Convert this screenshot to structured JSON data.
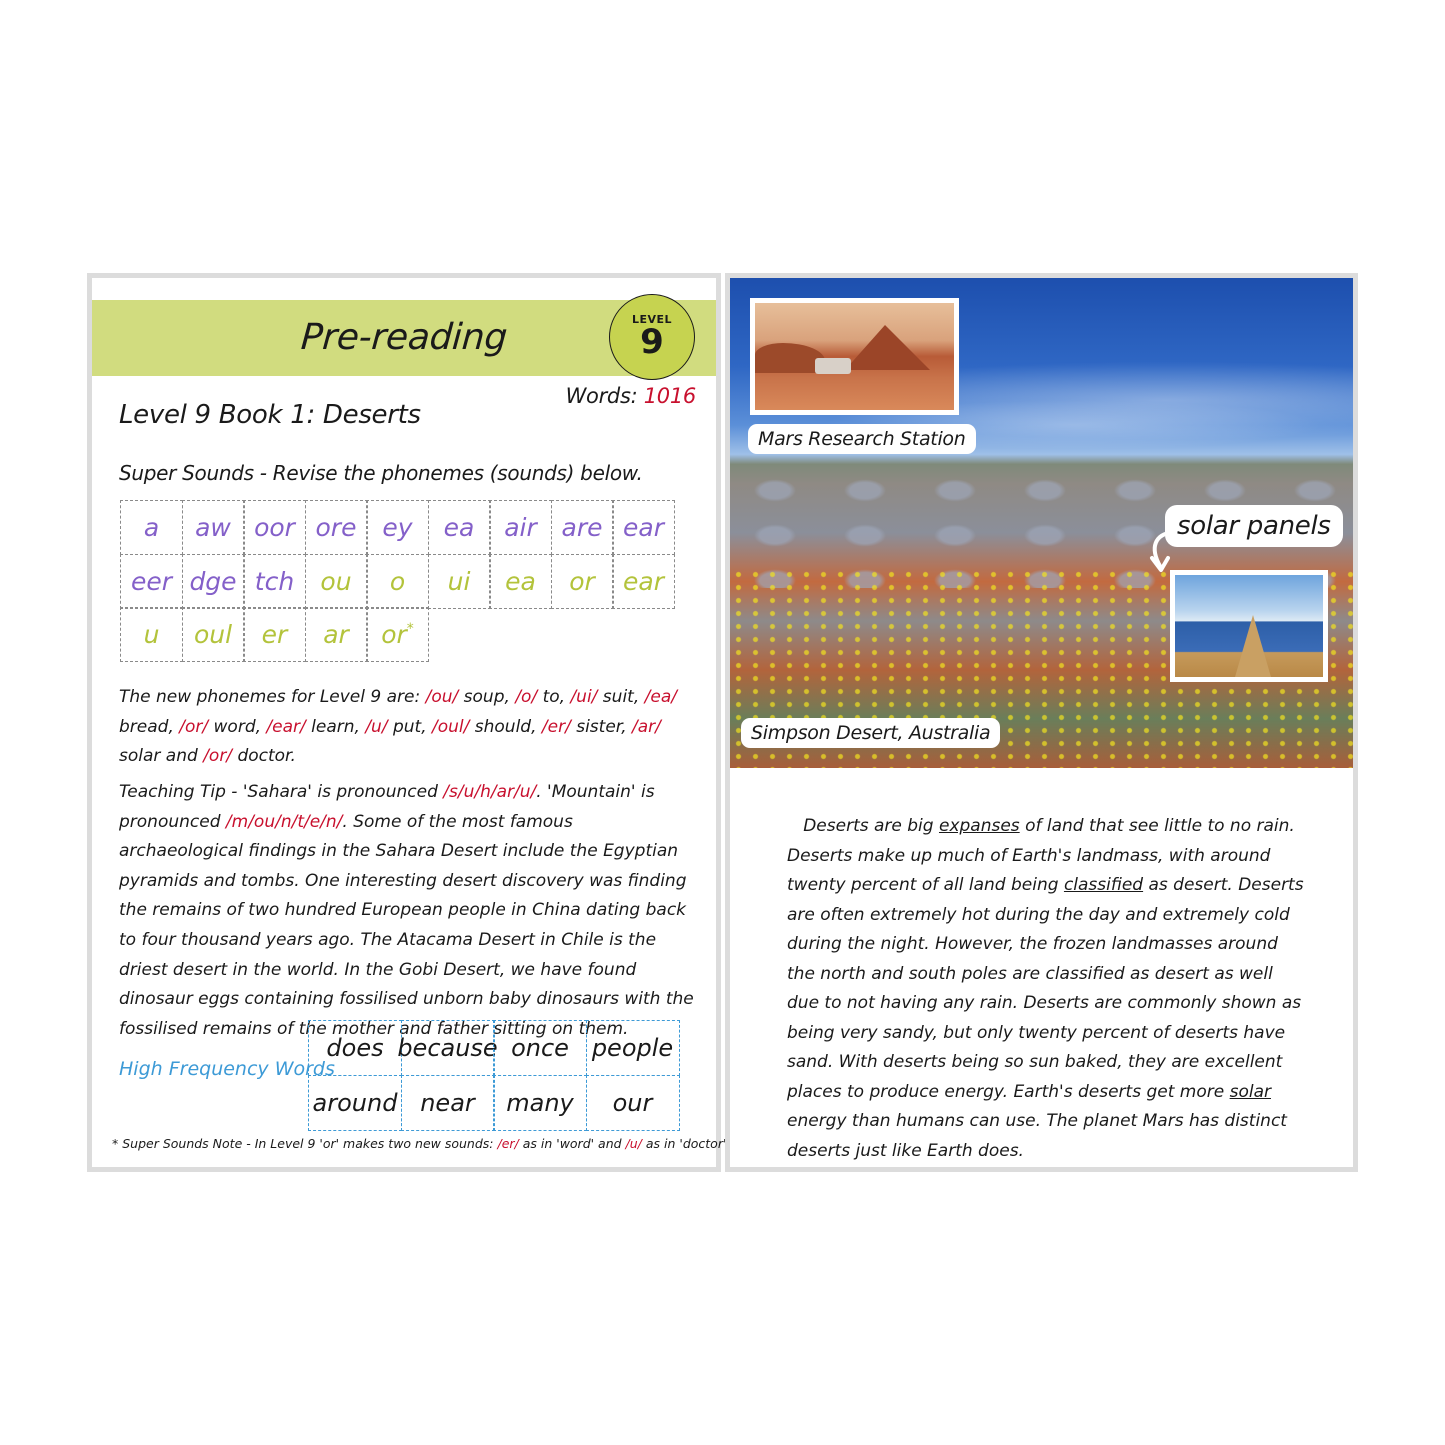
{
  "left_page": {
    "banner_title": "Pre-reading",
    "level_badge": {
      "label": "LEVEL",
      "number": "9"
    },
    "word_count": {
      "label": "Words: ",
      "value": "1016"
    },
    "book_title": "Level 9 Book 1: Deserts",
    "super_sounds_title": "Super Sounds - Revise the phonemes (sounds) below.",
    "phoneme_grid": [
      [
        {
          "text": "a",
          "color": "purple"
        },
        {
          "text": "aw",
          "color": "purple"
        },
        {
          "text": "oor",
          "color": "purple"
        },
        {
          "text": "ore",
          "color": "purple"
        },
        {
          "text": "ey",
          "color": "purple"
        },
        {
          "text": "ea",
          "color": "purple"
        },
        {
          "text": "air",
          "color": "purple"
        },
        {
          "text": "are",
          "color": "purple"
        },
        {
          "text": "ear",
          "color": "purple"
        }
      ],
      [
        {
          "text": "eer",
          "color": "purple"
        },
        {
          "text": "dge",
          "color": "purple"
        },
        {
          "text": "tch",
          "color": "purple"
        },
        {
          "text": "ou",
          "color": "lime"
        },
        {
          "text": "o",
          "color": "lime"
        },
        {
          "text": "ui",
          "color": "lime"
        },
        {
          "text": "ea",
          "color": "lime"
        },
        {
          "text": "or",
          "color": "lime"
        },
        {
          "text": "ear",
          "color": "lime"
        }
      ],
      [
        {
          "text": "u",
          "color": "lime"
        },
        {
          "text": "oul",
          "color": "lime"
        },
        {
          "text": "er",
          "color": "lime"
        },
        {
          "text": "ar",
          "color": "lime"
        },
        {
          "text": "or",
          "color": "lime",
          "mark": "*"
        }
      ]
    ],
    "new_phonemes": [
      {
        "t": "The new phonemes for Level 9 are: "
      },
      {
        "t": "/ou/",
        "red": true
      },
      {
        "t": " soup, "
      },
      {
        "t": "/o/",
        "red": true
      },
      {
        "t": " to, "
      },
      {
        "t": "/ui/",
        "red": true
      },
      {
        "t": " suit, "
      },
      {
        "t": "/ea/",
        "red": true
      },
      {
        "t": " bread, "
      },
      {
        "t": "/or/",
        "red": true
      },
      {
        "t": " word, "
      },
      {
        "t": "/ear/",
        "red": true
      },
      {
        "t": " learn, "
      },
      {
        "t": "/u/",
        "red": true
      },
      {
        "t": " put, "
      },
      {
        "t": "/oul/",
        "red": true
      },
      {
        "t": " should, "
      },
      {
        "t": "/er/",
        "red": true
      },
      {
        "t": " sister, "
      },
      {
        "t": "/ar/",
        "red": true
      },
      {
        "t": " solar and "
      },
      {
        "t": "/or/",
        "red": true
      },
      {
        "t": " doctor."
      }
    ],
    "teaching_tip": [
      {
        "t": "Teaching Tip - 'Sahara' is pronounced "
      },
      {
        "t": "/s/u/h/ar/u/",
        "red": true
      },
      {
        "t": ". 'Mountain' is pronounced "
      },
      {
        "t": "/m/ou/n/t/e/n/",
        "red": true
      },
      {
        "t": ". Some of the most famous archaeological findings in the Sahara Desert include the Egyptian pyramids and tombs. One interesting desert discovery was finding the remains of two hundred European people in China dating back to four thousand years ago. The Atacama Desert in Chile is the driest desert in the world. In the Gobi Desert, we have found dinosaur eggs containing fossilised unborn baby dinosaurs with the fossilised remains of the mother and father sitting on them."
      }
    ],
    "high_frequency": {
      "label": "High Frequency Words",
      "words": [
        [
          "does",
          "because",
          "once",
          "people"
        ],
        [
          "around",
          "near",
          "many",
          "our"
        ]
      ]
    },
    "footnote": [
      {
        "t": "* Super Sounds Note - In Level 9 'or' makes two new sounds: "
      },
      {
        "t": "/er/",
        "red": true
      },
      {
        "t": " as in 'word' and "
      },
      {
        "t": "/u/",
        "red": true
      },
      {
        "t": " as in 'doctor'."
      }
    ]
  },
  "right_page": {
    "captions": {
      "mars": "Mars Research Station",
      "solar": "solar panels",
      "simpson": "Simpson Desert, Australia"
    },
    "images": {
      "main": "desert-landscape-photo",
      "mars": "mars-research-station-photo",
      "solar": "solar-panels-photo"
    },
    "body_text": [
      {
        "t": "Deserts are big "
      },
      {
        "t": "expanses",
        "u": true
      },
      {
        "t": " of land that see little to no rain. Deserts make up much of Earth's landmass, with around twenty percent of all land being "
      },
      {
        "t": "classified",
        "u": true
      },
      {
        "t": " as desert. Deserts are often extremely hot during the day and extremely cold during the night. However, the frozen landmasses around the north and south poles are classified as desert as well due to not having any rain. Deserts are commonly shown as being very sandy, but only twenty percent of deserts have sand. With deserts being so sun baked, they are excellent places to produce energy. Earth's deserts get more "
      },
      {
        "t": "solar",
        "u": true
      },
      {
        "t": " energy than humans can use. The planet Mars has distinct deserts just like Earth does."
      }
    ]
  },
  "colors": {
    "banner": "#d1dc7f",
    "badge": "#c6d350",
    "phoneme_purple": "#8460c9",
    "phoneme_lime": "#b3c33b",
    "highlight_red": "#c8102e",
    "hfw_blue": "#3d9ad6",
    "page_border": "#dcdcdc"
  }
}
